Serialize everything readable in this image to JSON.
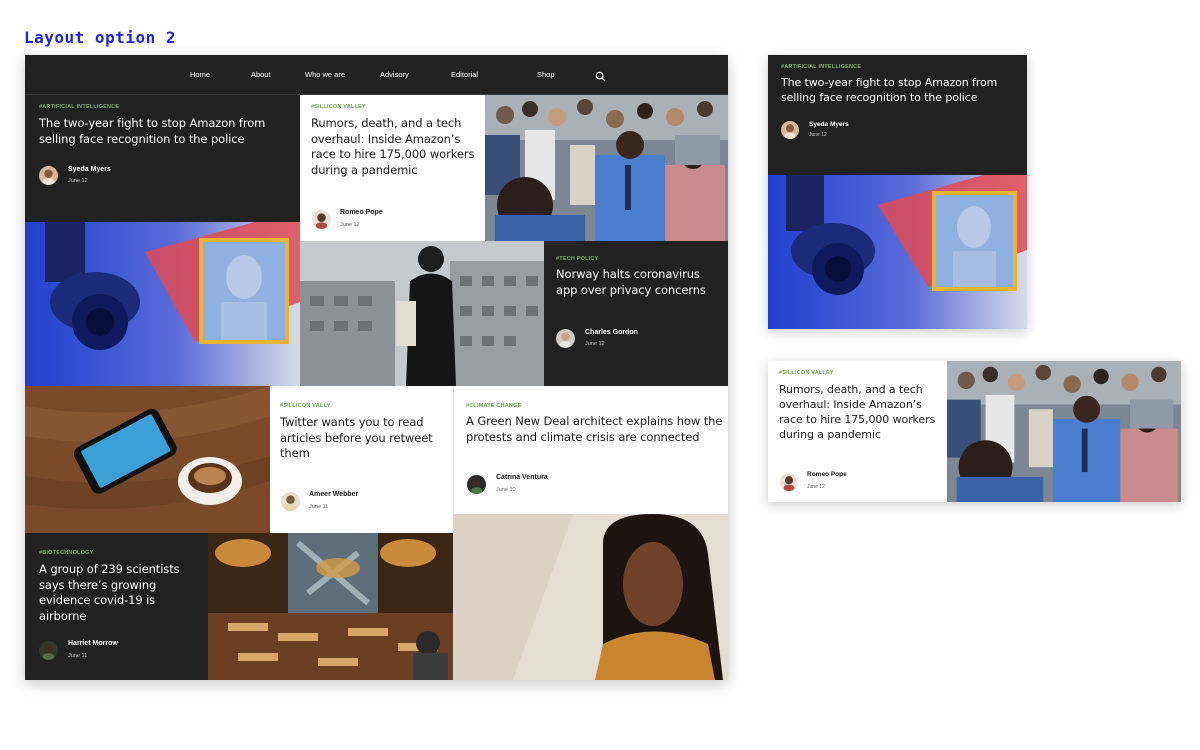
{
  "layout_title": "Layout option 2",
  "nav": {
    "items": [
      "Home",
      "About",
      "Who we are",
      "Advisory",
      "Editorial",
      "Shop"
    ],
    "search_icon": "search-icon"
  },
  "articles": {
    "amazon_face": {
      "tag": "#ARTIFICIAL INTELLIGENCE",
      "headline": "The two-year fight to stop Amazon from selling face recognition to the police",
      "author": "Syeda Myers",
      "date": "June 12"
    },
    "amazon_hire": {
      "tag": "#SILLICON VALLEY",
      "headline": "Rumors, death, and a tech overhaul: Inside Amazon’s race to hire 175,000 workers during a pandemic",
      "author": "Romeo Pope",
      "date": "June 12"
    },
    "norway": {
      "tag": "#TECH POLICY",
      "headline": "Norway halts coronavirus app over privacy concerns",
      "author": "Charles Gordon",
      "date": "June 12"
    },
    "twitter": {
      "tag": "#SILLICON VALLY",
      "headline": "Twitter wants you to read articles before you retweet them",
      "author": "Ameer Webber",
      "date": "June 11"
    },
    "green_deal": {
      "tag": "#CLIMATE CHANGE",
      "headline": "A Green New Deal architect explains how the protests and climate crisis are connected",
      "author": "Catrina Ventura",
      "date": "June 10"
    },
    "covid": {
      "tag": "#BIOTECHNOLOGY",
      "headline": "A group of 239 scientists says there’s growing evidence covid-19 is airborne",
      "author": "Harriet Morrow",
      "date": "June 11"
    }
  },
  "colors": {
    "dark_card": "#212121",
    "tag_green": "#7fb069",
    "title_blue": "#1d20e8",
    "frame_yellow": "#e8b531"
  }
}
